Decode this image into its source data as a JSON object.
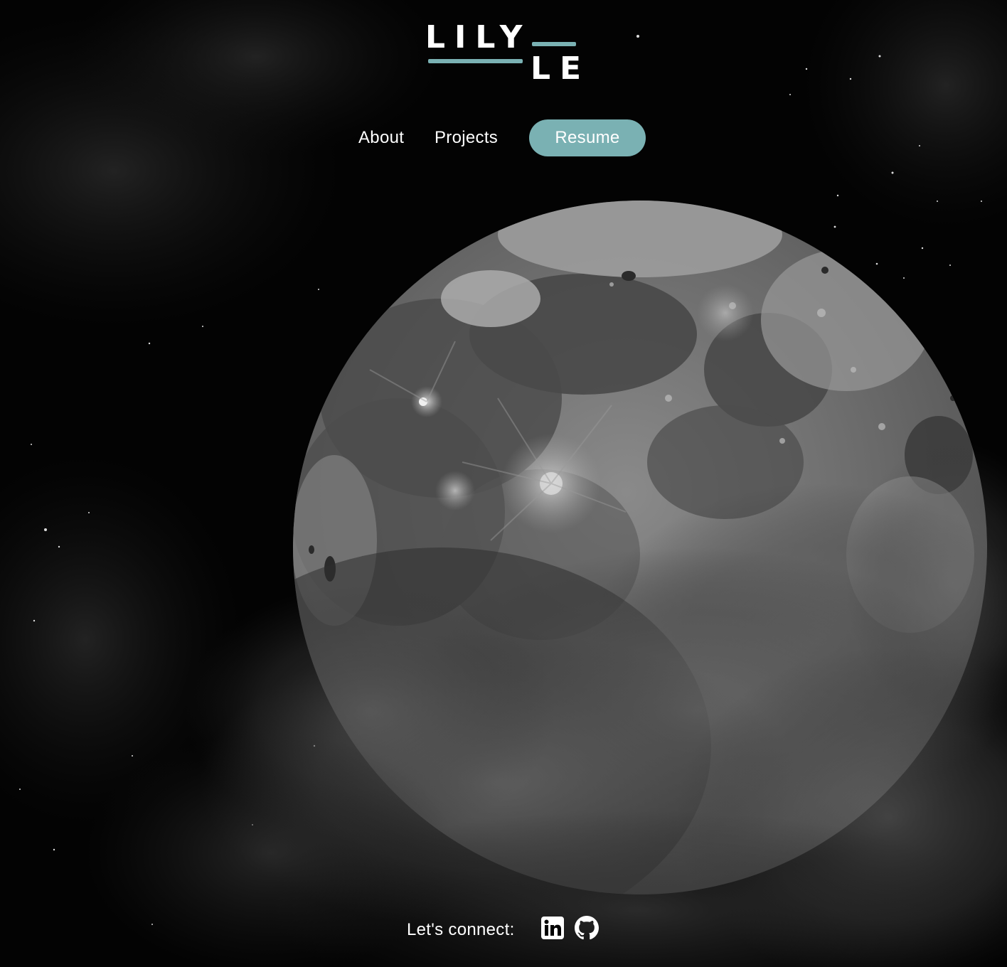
{
  "brand": {
    "first_name": "LILY",
    "last_name": "LE",
    "accent_color": "#7ab1b3"
  },
  "nav": {
    "items": [
      {
        "label": "About"
      },
      {
        "label": "Projects"
      }
    ],
    "resume_label": "Resume"
  },
  "footer": {
    "connect_label": "Let's connect:",
    "social": [
      {
        "icon": "linkedin-icon"
      },
      {
        "icon": "github-icon"
      }
    ]
  },
  "background": {
    "description_icon": "moon-hero-image"
  }
}
